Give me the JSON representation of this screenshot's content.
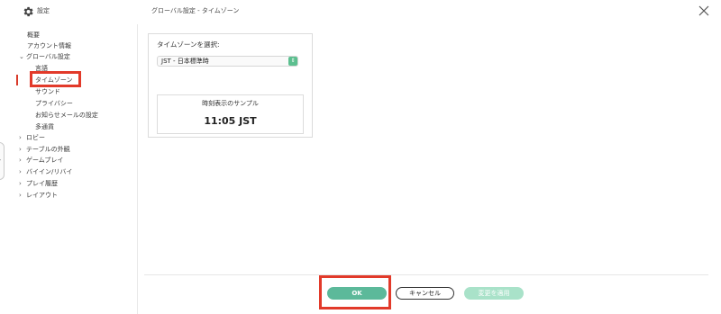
{
  "titlebar": {
    "app_label": "設定",
    "window_title": "グローバル設定 - タイムゾーン"
  },
  "sidebar": {
    "items": [
      {
        "label": "概要"
      },
      {
        "label": "アカウント情報"
      },
      {
        "label": "グローバル設定"
      },
      {
        "label": "言語"
      },
      {
        "label": "タイムゾーン"
      },
      {
        "label": "サウンド"
      },
      {
        "label": "プライバシー"
      },
      {
        "label": "お知らせメールの設定"
      },
      {
        "label": "多通貨"
      },
      {
        "label": "ロビー"
      },
      {
        "label": "テーブルの外観"
      },
      {
        "label": "ゲームプレイ"
      },
      {
        "label": "バイイン/リバイ"
      },
      {
        "label": "プレイ履歴"
      },
      {
        "label": "レイアウト"
      }
    ]
  },
  "timezone": {
    "label": "タイムゾーンを選択:",
    "selected": "JST - 日本標準時"
  },
  "sample": {
    "title": "時刻表示のサンプル",
    "time": "11:05 JST"
  },
  "buttons": {
    "ok": "OK",
    "cancel": "キャンセル",
    "apply": "変更を適用"
  },
  "colors": {
    "accent": "#5cb99a",
    "highlight": "#e23a2a"
  }
}
